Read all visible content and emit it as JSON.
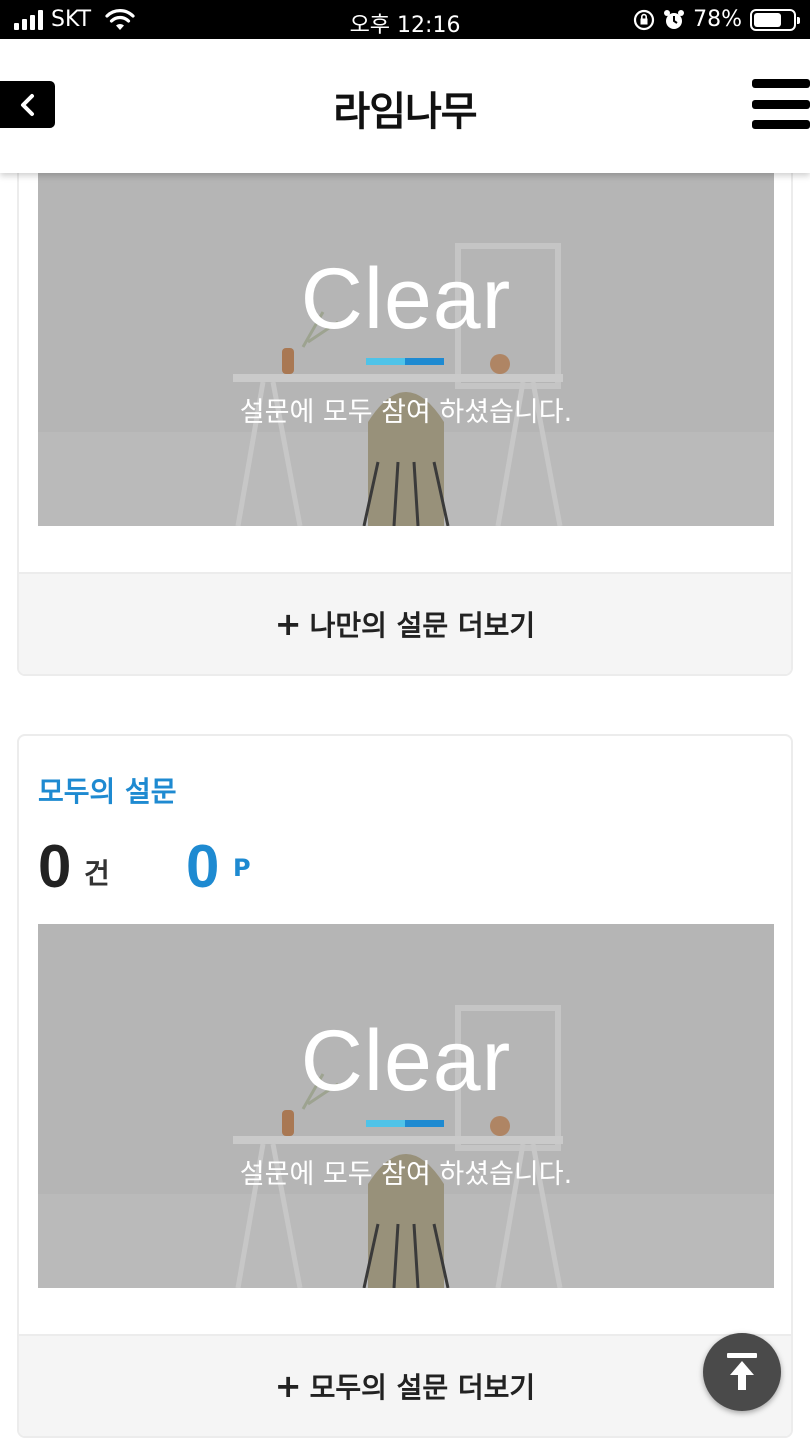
{
  "status_bar": {
    "carrier": "SKT",
    "time": "오후 12:16",
    "battery_percent": "78%",
    "battery_level": 0.78
  },
  "header": {
    "title": "라임나무",
    "back_icon": "chevron-left-icon",
    "menu_icon": "hamburger-menu-icon"
  },
  "my_survey": {
    "banner": {
      "headline": "Clear",
      "message": "설문에 모두 참여 하셨습니다."
    },
    "more_label": "나만의 설문 더보기",
    "more_icon": "plus-icon"
  },
  "all_survey": {
    "title": "모두의 설문",
    "count_value": "0",
    "count_unit": "건",
    "point_value": "0",
    "point_unit": "P",
    "banner": {
      "headline": "Clear",
      "message": "설문에 모두 참여 하셨습니다."
    },
    "more_label": "모두의 설문 더보기",
    "more_icon": "plus-icon"
  },
  "scroll_top_icon": "arrow-up-to-top-icon",
  "colors": {
    "accent": "#1e8ad1",
    "accent_light": "#4fc3e8",
    "header_bg": "#ffffff",
    "status_bar_bg": "#000000"
  }
}
